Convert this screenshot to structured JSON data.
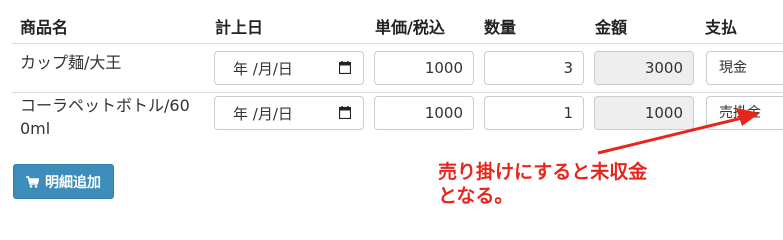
{
  "headers": {
    "product": "商品名",
    "date": "計上日",
    "unit_price": "単価/税込",
    "quantity": "数量",
    "amount": "金額",
    "payment": "支払"
  },
  "rows": [
    {
      "product": "カップ麺/大王",
      "date_placeholder": "年 /月/日",
      "unit_price": "1000",
      "quantity": "3",
      "amount": "3000",
      "payment": "現金"
    },
    {
      "product_line1": "コーラペットボトル/60",
      "product_line2": "0ml",
      "date_placeholder": "年 /月/日",
      "unit_price": "1000",
      "quantity": "1",
      "amount": "1000",
      "payment": "売掛金"
    }
  ],
  "add_button_label": "明細追加",
  "annotation": {
    "line1": "売り掛けにすると未収金",
    "line2": "となる。"
  },
  "colors": {
    "primary_button": "#3c8dbc",
    "annotation": "#e8251b",
    "readonly_bg": "#eeeeee"
  },
  "icons": {
    "date": "calendar-icon",
    "add": "cart-icon"
  }
}
